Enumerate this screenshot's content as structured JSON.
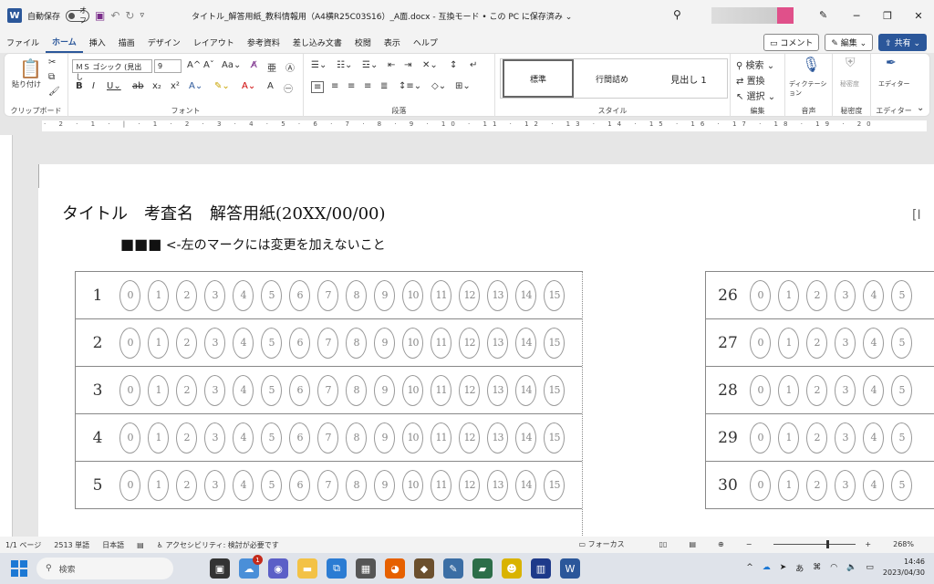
{
  "titlebar": {
    "autosave_label": "自動保存",
    "autosave_state": "オフ",
    "document_title": "タイトル_解答用紙_教科情報用（A4横R25C03S16）_A面.docx  -  互換モード • この PC に保存済み ⌄"
  },
  "menu": {
    "tabs": [
      "ファイル",
      "ホーム",
      "挿入",
      "描画",
      "デザイン",
      "レイアウト",
      "参考資料",
      "差し込み文書",
      "校閲",
      "表示",
      "ヘルプ"
    ],
    "active_tab": "ホーム",
    "comment_label": "コメント",
    "edit_label": "編集",
    "share_label": "共有"
  },
  "ribbon": {
    "clipboard": {
      "paste_label": "貼り付け",
      "group_label": "クリップボード"
    },
    "font": {
      "font_name": "ＭＳ ゴシック (見出し",
      "font_size": "9",
      "group_label": "フォント"
    },
    "paragraph": {
      "group_label": "段落"
    },
    "styles": {
      "items": [
        "標準",
        "行間詰め",
        "見出し 1"
      ],
      "group_label": "スタイル"
    },
    "editing": {
      "search_label": "検索",
      "replace_label": "置換",
      "select_label": "選択",
      "group_label": "編集"
    },
    "voice": {
      "dictate_label": "ディクテーション",
      "group_label": "音声"
    },
    "sensitivity": {
      "label": "秘密度",
      "group_label": "秘密度"
    },
    "editor": {
      "label": "エディター",
      "group_label": "エディター"
    }
  },
  "document": {
    "heading": "タイトル　考査名　解答用紙(20XX/00/00)",
    "marks": "■■■",
    "note": "<-左のマークには変更を加えないこと",
    "bubbles": [
      "0",
      "1",
      "2",
      "3",
      "4",
      "5",
      "6",
      "7",
      "8",
      "9",
      "10",
      "11",
      "12",
      "13",
      "14",
      "15"
    ],
    "left_rows": [
      "1",
      "2",
      "3",
      "4",
      "5"
    ],
    "right_rows": [
      "26",
      "27",
      "28",
      "29",
      "30"
    ],
    "right_bubbles": [
      "0",
      "1",
      "2",
      "3",
      "4",
      "5"
    ]
  },
  "statusbar": {
    "page": "1/1 ページ",
    "words": "2513 単語",
    "language": "日本語",
    "accessibility": "アクセシビリティ: 検討が必要です",
    "focus": "フォーカス",
    "zoom": "268%"
  },
  "taskbar": {
    "search_placeholder": "検索",
    "badge_count": "1",
    "time": "14:46",
    "date": "2023/04/30"
  }
}
